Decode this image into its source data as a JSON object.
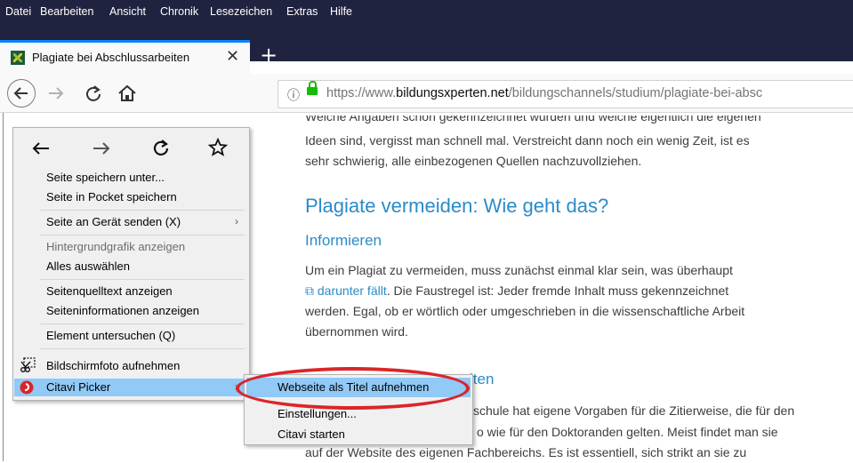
{
  "menubar": {
    "items": [
      "Datei",
      "Bearbeiten",
      "Ansicht",
      "Chronik",
      "Lesezeichen",
      "Extras",
      "Hilfe"
    ]
  },
  "tab": {
    "title": "Plagiate bei Abschlussarbeiten",
    "close": "✕",
    "new_tab": "+"
  },
  "urlbar": {
    "info_icon": "info-icon",
    "url_prefix": "https://www.",
    "url_domain": "bildungsxperten.net",
    "url_path": "/bildungschannels/studium/plagiate-bei-absc"
  },
  "content": {
    "p1_line0": "Welche Angaben schon gekennzeichnet wurden und welche eigentlich die eigenen",
    "p1_line1": "Ideen sind, vergisst man schnell mal. Verstreicht dann noch ein wenig Zeit, ist es",
    "p1_line2": "sehr schwierig, alle einbezogenen Quellen nachzuvollziehen.",
    "h2": "Plagiate vermeiden: Wie geht das?",
    "h3_1": "Informieren",
    "p2_line1": "Um ein Plagiat zu vermeiden, muss zunächst einmal klar sein, was überhaupt",
    "p2_link": "darunter fällt",
    "p2_line2_rest": ". Die Faustregel ist: Jeder fremde Inhalt muss gekennzeichnet",
    "p2_line3": "werden. Egal, ob er wörtlich oder umgeschrieben in die wissenschaftliche Arbeit",
    "p2_line4": "übernommen wird.",
    "h3_2_visible": "lten",
    "p3_line1_visible": "schule hat eigene Vorgaben für die Zitierweise, die für den",
    "p3_line2_visible": "o wie für den Doktoranden gelten. Meist findet man sie",
    "p3_line3": "auf der Website des eigenen Fachbereichs. Es ist essentiell, sich strikt an sie zu"
  },
  "context_menu": {
    "nav_icons": [
      "back-icon",
      "forward-icon",
      "reload-icon",
      "bookmark-star-icon"
    ],
    "items": [
      {
        "label": "Seite speichern unter..."
      },
      {
        "label": "Seite in Pocket speichern"
      },
      {
        "label": "Seite an Gerät senden (X)"
      },
      {
        "label": "Hintergrundgrafik anzeigen"
      },
      {
        "label": "Alles auswählen"
      },
      {
        "label": "Seitenquelltext anzeigen"
      },
      {
        "label": "Seiteninformationen anzeigen"
      },
      {
        "label": "Element untersuchen (Q)"
      },
      {
        "label": "Bildschirmfoto aufnehmen"
      },
      {
        "label": "Citavi Picker"
      }
    ],
    "submenu_arrow": "›"
  },
  "submenu": {
    "items": [
      {
        "label": "Webseite als Titel aufnehmen"
      },
      {
        "label": "Einstellungen..."
      },
      {
        "label": "Citavi starten"
      }
    ]
  },
  "colors": {
    "menubar_bg": "#202340",
    "accent": "#0a84ff",
    "heading": "#2a8bc9",
    "highlight": "#91c9f7",
    "annotation": "#d9262a"
  }
}
